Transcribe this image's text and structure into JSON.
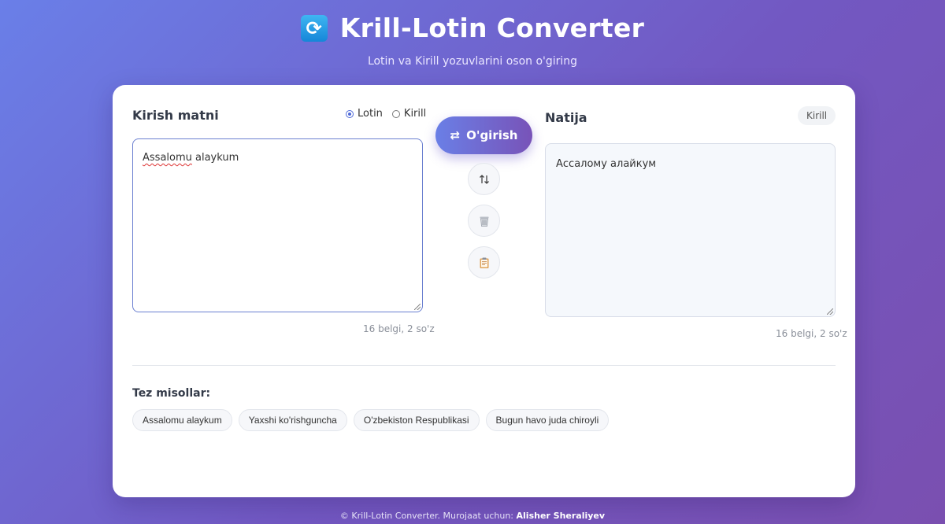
{
  "app": {
    "title": "Krill-Lotin Converter",
    "subtitle": "Lotin va Kirill yozuvlarini oson o'giring",
    "logo_icon": "refresh-icon"
  },
  "input_panel": {
    "title": "Kirish matni",
    "radio_options": [
      "Lotin",
      "Kirill"
    ],
    "selected_script": "Lotin",
    "text_word1": "Assalomu",
    "text_rest": " alaykum",
    "count": "16 belgi, 2 so'z"
  },
  "actions": {
    "convert_label": "O'girish",
    "convert_icon": "swap-icon",
    "swap_icon": "up-down-arrows-icon",
    "clear_icon": "trash-icon",
    "copy_icon": "clipboard-icon"
  },
  "output_panel": {
    "title": "Natija",
    "badge": "Kirill",
    "text": "Ассалому алайкум",
    "count": "16 belgi, 2 so'z"
  },
  "examples": {
    "title": "Tez misollar:",
    "items": [
      "Assalomu alaykum",
      "Yaxshi ko'rishguncha",
      "O'zbekiston Respublikasi",
      "Bugun havo juda chiroyli"
    ]
  },
  "footer": {
    "text": "© Krill-Lotin Converter. Murojaat uchun:",
    "author": "Alisher Sheraliyev"
  },
  "colors": {
    "background_start": "#6a7fe8",
    "background_end": "#7a4fb0",
    "accent": "#4f6ad8"
  }
}
